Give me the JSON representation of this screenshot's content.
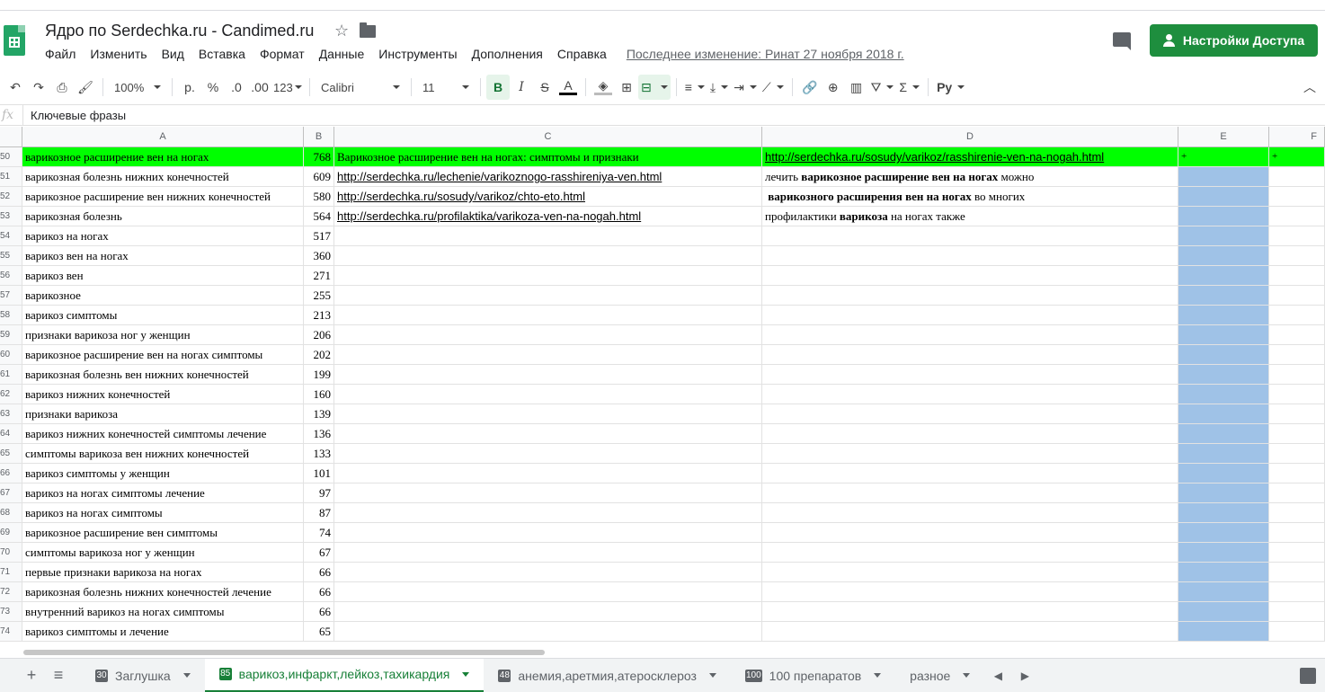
{
  "header": {
    "title": "Ядро по Serdechka.ru - Candimed.ru",
    "menu": [
      "Файл",
      "Изменить",
      "Вид",
      "Вставка",
      "Формат",
      "Данные",
      "Инструменты",
      "Дополнения",
      "Справка"
    ],
    "last_edit": "Последнее изменение: Ринат 27 ноября 2018 г.",
    "share_label": "Настройки Доступа"
  },
  "toolbar": {
    "zoom": "100%",
    "currency": "р.",
    "percent": "%",
    "dec_less": ".0",
    "dec_more": ".00",
    "format_more": "123",
    "font": "Calibri",
    "font_size": "11",
    "bold": "B",
    "italic": "I",
    "strike": "S",
    "text_color": "A",
    "input_tools": "Py",
    "accent": "#1e8e3e"
  },
  "formula_bar": {
    "fx": "fx",
    "content": "Ключевые фразы"
  },
  "columns": [
    "A",
    "B",
    "C",
    "D",
    "E",
    "F"
  ],
  "rows": [
    {
      "n": "50",
      "a": "варикозное расширение вен на ногах",
      "b": "768",
      "c": "Варикозное расширение вен на ногах: симптомы и признаки",
      "d_link": "http://serdechka.ru/sosudy/varikoz/rasshirenie-ven-na-nogah.html",
      "e": "+",
      "f": "+",
      "highlight": true
    },
    {
      "n": "51",
      "a": "варикозная болезнь нижних конечностей",
      "b": "609",
      "c_link": "http://serdechka.ru/lechenie/varikoznogo-rasshireniya-ven.html",
      "d_pre": "лечить ",
      "d_bold": "варикозное расширение вен на ногах",
      "d_post": " можно"
    },
    {
      "n": "52",
      "a": "варикозное расширение вен нижних конечностей",
      "b": "580",
      "c_link": "http://serdechka.ru/sosudy/varikoz/chto-eto.html",
      "d_pre": " ",
      "d_bold": "варикозного расширения вен на ногах",
      "d_post": " во многих"
    },
    {
      "n": "53",
      "a": "варикозная болезнь",
      "b": "564",
      "c_link": "http://serdechka.ru/profilaktika/varikoza-ven-na-nogah.html",
      "d_pre": "профилактики ",
      "d_bold": "варикоза",
      "d_post": " на ногах также"
    },
    {
      "n": "54",
      "a": "варикоз на ногах",
      "b": "517"
    },
    {
      "n": "55",
      "a": "варикоз вен на ногах",
      "b": "360"
    },
    {
      "n": "56",
      "a": "варикоз вен",
      "b": "271"
    },
    {
      "n": "57",
      "a": "варикозное",
      "b": "255"
    },
    {
      "n": "58",
      "a": "варикоз симптомы",
      "b": "213"
    },
    {
      "n": "59",
      "a": "признаки варикоза ног у женщин",
      "b": "206"
    },
    {
      "n": "60",
      "a": "варикозное расширение вен на ногах симптомы",
      "b": "202"
    },
    {
      "n": "61",
      "a": "варикозная болезнь вен нижних конечностей",
      "b": "199"
    },
    {
      "n": "62",
      "a": "варикоз нижних конечностей",
      "b": "160"
    },
    {
      "n": "63",
      "a": "признаки варикоза",
      "b": "139"
    },
    {
      "n": "64",
      "a": "варикоз нижних конечностей симптомы лечение",
      "b": "136"
    },
    {
      "n": "65",
      "a": "симптомы варикоза вен нижних конечностей",
      "b": "133"
    },
    {
      "n": "66",
      "a": "варикоз симптомы у женщин",
      "b": "101"
    },
    {
      "n": "67",
      "a": "варикоз на ногах симптомы лечение",
      "b": "97"
    },
    {
      "n": "68",
      "a": "варикоз на ногах симптомы",
      "b": "87"
    },
    {
      "n": "69",
      "a": "варикозное расширение вен симптомы",
      "b": "74"
    },
    {
      "n": "70",
      "a": "симптомы варикоза ног у женщин",
      "b": "67"
    },
    {
      "n": "71",
      "a": "первые признаки варикоза на ногах",
      "b": "66"
    },
    {
      "n": "72",
      "a": "варикозная болезнь нижних конечностей лечение",
      "b": "66"
    },
    {
      "n": "73",
      "a": "внутренний варикоз на ногах симптомы",
      "b": "66"
    },
    {
      "n": "74",
      "a": "варикоз симптомы и лечение",
      "b": "65"
    }
  ],
  "sheets": [
    {
      "badge": "30",
      "name": "Заглушка"
    },
    {
      "badge": "85",
      "name": "варикоз,инфаркт,лейкоз,тахикардия",
      "active": true
    },
    {
      "badge": "48",
      "name": "анемия,аретмия,атеросклероз"
    },
    {
      "badge": "100",
      "name": "100 препаратов"
    },
    {
      "badge": "",
      "name": "разное"
    }
  ],
  "colors": {
    "highlight_row": "#00ff00",
    "selected_column": "#9fc2e7",
    "active_sheet": "#188038"
  }
}
